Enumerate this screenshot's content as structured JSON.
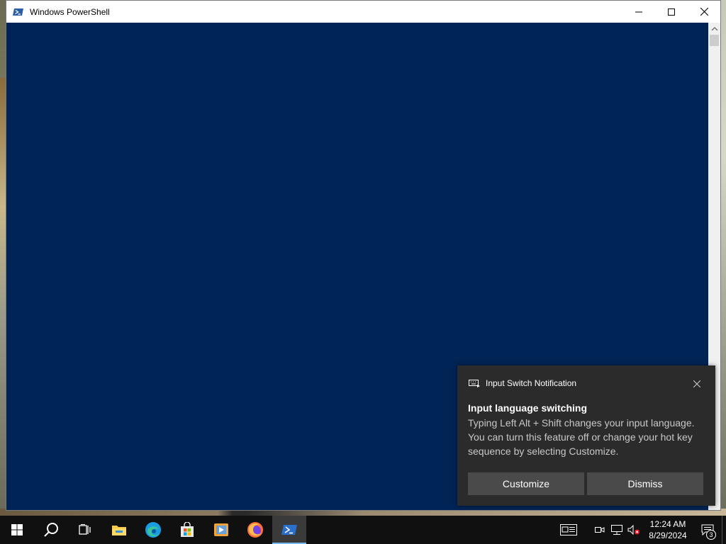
{
  "window": {
    "title": "Windows PowerShell",
    "console_bg": "#012456"
  },
  "toast": {
    "app_name": "Input Switch Notification",
    "title": "Input language switching",
    "body": "Typing Left Alt + Shift changes your input language. You can turn this feature off or change your hot key sequence by selecting Customize.",
    "customize_label": "Customize",
    "dismiss_label": "Dismiss"
  },
  "taskbar": {
    "items": [
      {
        "name": "start",
        "icon": "windows-logo-icon"
      },
      {
        "name": "search",
        "icon": "search-icon"
      },
      {
        "name": "task-view",
        "icon": "task-view-icon"
      },
      {
        "name": "file-explorer",
        "icon": "folder-icon"
      },
      {
        "name": "edge",
        "icon": "edge-icon"
      },
      {
        "name": "store",
        "icon": "store-icon"
      },
      {
        "name": "media",
        "icon": "media-player-icon"
      },
      {
        "name": "firefox",
        "icon": "firefox-icon"
      },
      {
        "name": "powershell",
        "icon": "powershell-icon",
        "active": true
      }
    ],
    "clock_time": "12:24 AM",
    "clock_date": "8/29/2024",
    "notification_count": "3"
  }
}
